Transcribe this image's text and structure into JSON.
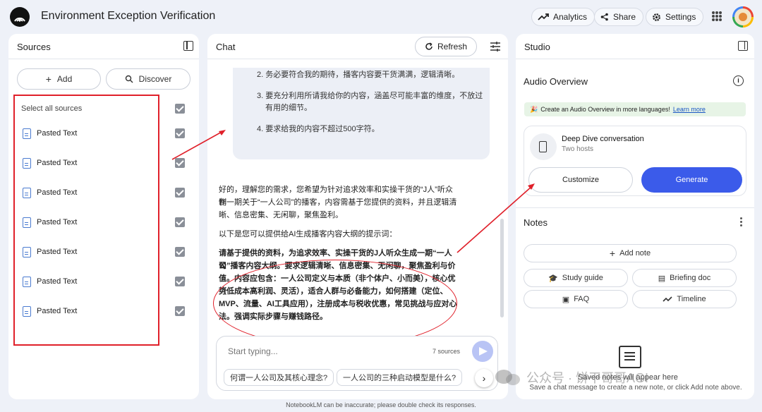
{
  "header": {
    "title": "Environment Exception Verification",
    "analytics": "Analytics",
    "share": "Share",
    "settings": "Settings"
  },
  "sources": {
    "title": "Sources",
    "add": "Add",
    "discover": "Discover",
    "select_all": "Select all sources",
    "items": [
      "Pasted Text",
      "Pasted Text",
      "Pasted Text",
      "Pasted Text",
      "Pasted Text",
      "Pasted Text",
      "Pasted Text"
    ]
  },
  "chat": {
    "title": "Chat",
    "refresh": "Refresh",
    "requirements": [
      "2. 务必要符合我的期待，播客内容要干货满满，逻辑清晰。",
      "3. 要充分利用所请我给你的内容，涵盖尽可能丰富的维度，不放过",
      "有用的细节。",
      "4. 要求给我的内容不超过500字符。"
    ],
    "answer_intro": [
      "好的，理解您的需求，您希望为针对追求效率和实操干货的“J人”听众制",
      "作一期关于“一人公司”的播客，内容需基于您提供的资料，并且逻辑清",
      "晰、信息密集、无闲聊，聚焦盈利。"
    ],
    "answer_lead": "以下是您可以提供给AI生成播客内容大纲的提示词：",
    "answer_prompt": [
      "请基于提供的资料，为追求效率、实操干货的J人听众生成一期“一人公",
      "司”播客内容大纲。要求逻辑清晰、信息密集、无闲聊，聚焦盈利与价",
      "值。内容应包含：一人公司定义与本质（非个体户、小而美），核心优势",
      "（低成本高利润、灵活），适合人群与必备能力，如何搭建（定位、",
      "MVP、流量、AI工具应用），注册成本与税收优惠，常见挑战与应对心",
      "法。强调实际步骤与赚钱路径。"
    ],
    "input_placeholder": "Start typing...",
    "source_count": "7 sources",
    "suggestions": [
      "何谓一人公司及其核心理念?",
      "一人公司的三种启动模型是什么?"
    ]
  },
  "studio": {
    "title": "Studio",
    "audio_overview": "Audio Overview",
    "banner_text": "Create an Audio Overview in more languages!",
    "banner_link": "Learn more",
    "deep_dive_title": "Deep Dive conversation",
    "deep_dive_sub": "Two hosts",
    "customize": "Customize",
    "generate": "Generate",
    "notes": "Notes",
    "add_note": "Add note",
    "study_guide": "Study guide",
    "briefing_doc": "Briefing doc",
    "faq": "FAQ",
    "timeline": "Timeline",
    "empty_title": "Saved notes will appear here",
    "empty_sub": "Save a chat message to create a new note, or click Add note above."
  },
  "watermark": "公众号 · 饼干哥哥AGI",
  "footer": "NotebookLM can be inaccurate; please double check its responses.",
  "colors": {
    "accent": "#3b5bea",
    "annotation": "#e0202a",
    "background": "#eef1f8"
  }
}
